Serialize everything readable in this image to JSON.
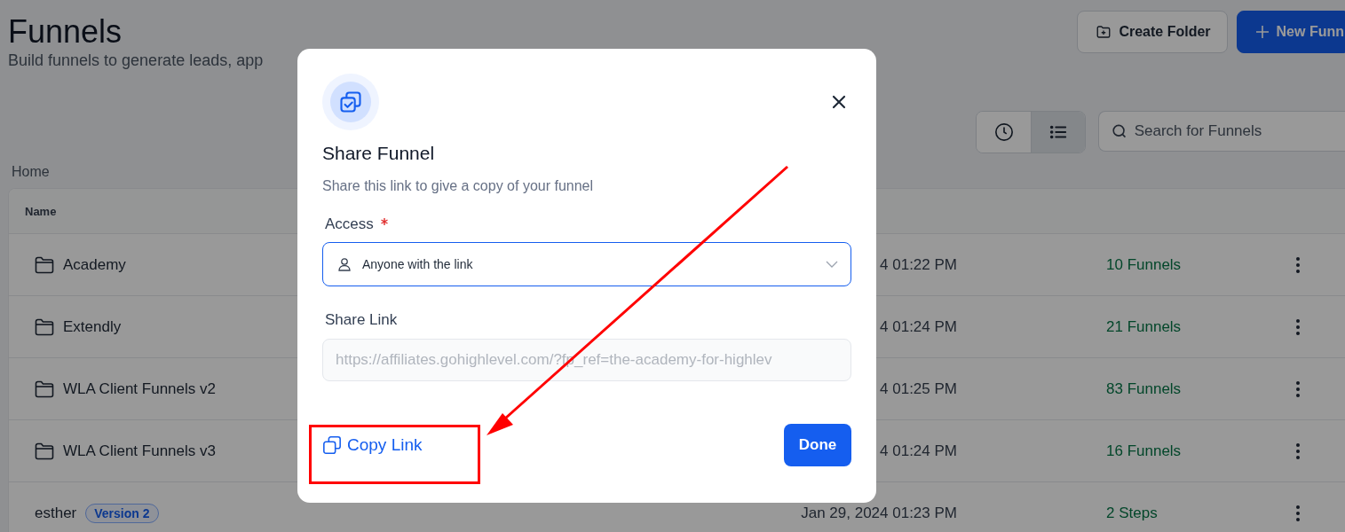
{
  "page": {
    "title": "Funnels",
    "subtitle": "Build funnels to generate leads, app"
  },
  "actions": [
    {
      "label": "Create Folder",
      "kind": "secondary"
    },
    {
      "label": "New Funn",
      "kind": "primary"
    }
  ],
  "view_toggle": [
    {
      "kind": "clock",
      "selected": false
    },
    {
      "kind": "list",
      "selected": true
    }
  ],
  "search": {
    "placeholder": "Search for Funnels"
  },
  "breadcrumb": "Home",
  "table": {
    "columns": [
      "Name"
    ],
    "rows": [
      {
        "kind": "folder",
        "name": "Academy",
        "date": "4 01:22 PM",
        "count": "10 Funnels"
      },
      {
        "kind": "folder",
        "name": "Extendly",
        "date": "4 01:24 PM",
        "count": "21 Funnels"
      },
      {
        "kind": "folder",
        "name": "WLA Client Funnels v2",
        "date": "4 01:25 PM",
        "count": "83 Funnels"
      },
      {
        "kind": "folder",
        "name": "WLA Client Funnels v3",
        "date": "4 01:24 PM",
        "count": "16 Funnels"
      },
      {
        "kind": "funnel",
        "name": "esther",
        "badge": "Version 2",
        "date": "Jan 29, 2024 01:23 PM",
        "count": "2 Steps"
      }
    ]
  },
  "dialog": {
    "title": "Share Funnel",
    "description": "Share this link to give a copy of your funnel",
    "access": {
      "label": "Access",
      "required": true,
      "value": "Anyone with the link"
    },
    "share_link": {
      "label": "Share Link",
      "value": "https://affiliates.gohighlevel.com/?fp_ref=the-academy-for-highlev",
      "disabled": true
    },
    "copy_button": "Copy Link",
    "done_button": "Done"
  }
}
